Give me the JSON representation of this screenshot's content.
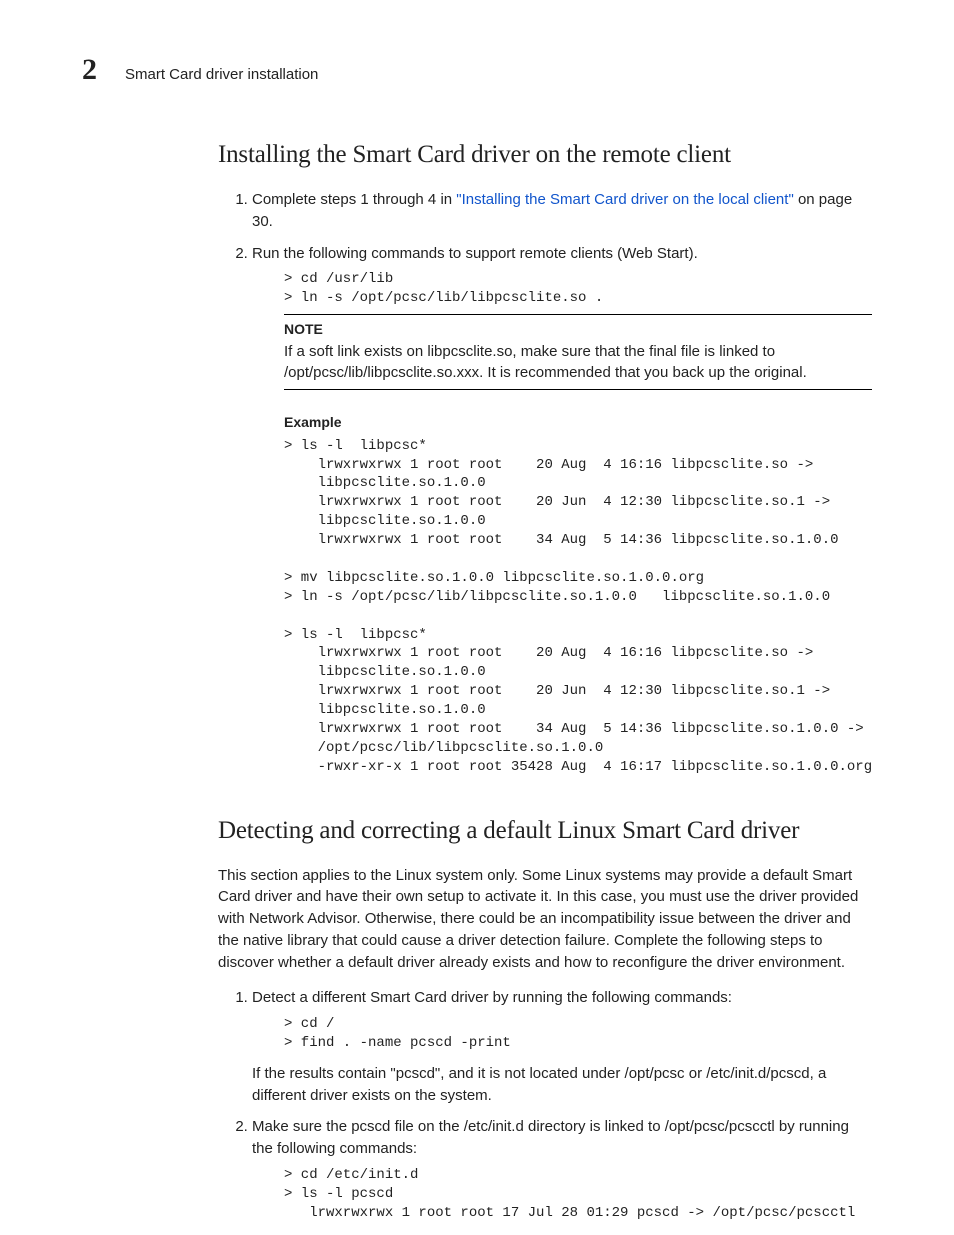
{
  "header": {
    "chapter_number": "2",
    "running_title": "Smart Card driver installation"
  },
  "section1": {
    "heading": "Installing the Smart Card driver on the remote client",
    "step1_prefix": "Complete steps 1 through 4 in ",
    "step1_link": "\"Installing the Smart Card driver on the local client\"",
    "step1_suffix": " on page 30.",
    "step2": "Run the following commands to support remote clients (Web Start).",
    "code1": "> cd /usr/lib\n> ln -s /opt/pcsc/lib/libpcsclite.so .",
    "note_label": "NOTE",
    "note_body": "If a soft link exists on libpcsclite.so, make sure that the final file is linked to /opt/pcsc/lib/libpcsclite.so.xxx. It is recommended that you back up the original.",
    "example_label": "Example",
    "example_code": "> ls -l  libpcsc*\n    lrwxrwxrwx 1 root root    20 Aug  4 16:16 libpcsclite.so ->\n    libpcsclite.so.1.0.0\n    lrwxrwxrwx 1 root root    20 Jun  4 12:30 libpcsclite.so.1 ->\n    libpcsclite.so.1.0.0\n    lrwxrwxrwx 1 root root    34 Aug  5 14:36 libpcsclite.so.1.0.0\n\n> mv libpcsclite.so.1.0.0 libpcsclite.so.1.0.0.org\n> ln -s /opt/pcsc/lib/libpcsclite.so.1.0.0   libpcsclite.so.1.0.0\n\n> ls -l  libpcsc*\n    lrwxrwxrwx 1 root root    20 Aug  4 16:16 libpcsclite.so ->\n    libpcsclite.so.1.0.0\n    lrwxrwxrwx 1 root root    20 Jun  4 12:30 libpcsclite.so.1 ->\n    libpcsclite.so.1.0.0\n    lrwxrwxrwx 1 root root    34 Aug  5 14:36 libpcsclite.so.1.0.0 ->\n    /opt/pcsc/lib/libpcsclite.so.1.0.0\n    -rwxr-xr-x 1 root root 35428 Aug  4 16:17 libpcsclite.so.1.0.0.org"
  },
  "section2": {
    "heading": "Detecting and correcting a default Linux Smart Card driver",
    "intro": "This section applies to the Linux system only. Some Linux systems may provide a default Smart Card driver and have their own setup to activate it. In this case, you must use the driver provided with Network Advisor. Otherwise, there could be an incompatibility issue between the driver and the native library that could cause a driver detection failure. Complete the following steps to discover whether a default driver already exists and how to reconfigure the driver environment.",
    "step1": "Detect a different Smart Card driver by running the following commands:",
    "code1": "> cd /\n> find . -name pcscd -print",
    "step1_after": "If the results contain \"pcscd\", and it is not located under /opt/pcsc or /etc/init.d/pcscd, a different driver exists on the system.",
    "step2": "Make sure the pcscd file on the /etc/init.d directory is linked to /opt/pcsc/pcscctl by running the following commands:",
    "code2": "> cd /etc/init.d\n> ls -l pcscd\n   lrwxrwxrwx 1 root root 17 Jul 28 01:29 pcscd -> /opt/pcsc/pcscctl"
  }
}
